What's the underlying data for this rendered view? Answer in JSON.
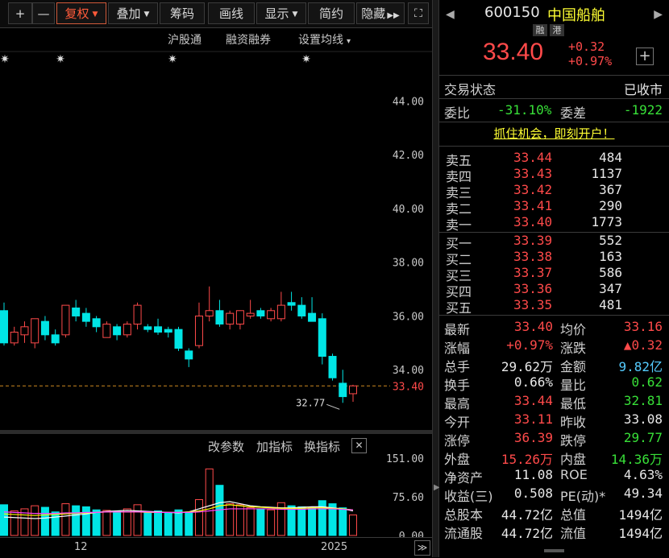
{
  "toolbar": {
    "plus": "+",
    "minus": "—",
    "fuquan": "复权",
    "diejia": "叠加",
    "chouma": "筹码",
    "huaxian": "画线",
    "xianshi": "显示",
    "jianyue": "简约",
    "yincang": "隐藏",
    "fullscreen": "⛶"
  },
  "chart_top": {
    "hugutong": "沪股通",
    "rongzi": "融资融券",
    "shezhi": "设置均线",
    "caret": "▾"
  },
  "price_axis": [
    "44.00",
    "42.00",
    "40.00",
    "38.00",
    "36.00",
    "34.00"
  ],
  "current_price_tag": "33.40",
  "low_annotation": "32.77",
  "volume_toolbar": {
    "gaicanshu": "改参数",
    "jiazhibiao": "加指标",
    "huanzhibiao": "换指标",
    "close": "✕"
  },
  "volume_axis": [
    "151.00",
    "75.60",
    "0.00"
  ],
  "time_axis": {
    "m12": "12",
    "y2025": "2025",
    "more": "≫"
  },
  "colors": {
    "up": "#ff4a4a",
    "down": "#00e5e5",
    "ma1": "#ffffff",
    "ma2": "#ffff00",
    "ma3": "#ff44ff"
  },
  "quote": {
    "code": "600150",
    "name": "中国船舶",
    "badge_rong": "融",
    "badge_gang": "港",
    "price": "33.40",
    "change": "+0.32",
    "change_pct": "+0.97%",
    "add": "+"
  },
  "status": {
    "label": "交易状态",
    "value": "已收市"
  },
  "weibi": {
    "label": "委比",
    "value": "-31.10%",
    "label2": "委差",
    "value2": "-1922"
  },
  "promo": "抓住机会，即刻开户！",
  "sell": [
    {
      "label": "卖五",
      "price": "33.44",
      "vol": "484"
    },
    {
      "label": "卖四",
      "price": "33.43",
      "vol": "1137"
    },
    {
      "label": "卖三",
      "price": "33.42",
      "vol": "367"
    },
    {
      "label": "卖二",
      "price": "33.41",
      "vol": "290"
    },
    {
      "label": "卖一",
      "price": "33.40",
      "vol": "1773"
    }
  ],
  "buy": [
    {
      "label": "买一",
      "price": "33.39",
      "vol": "552"
    },
    {
      "label": "买二",
      "price": "33.38",
      "vol": "163"
    },
    {
      "label": "买三",
      "price": "33.37",
      "vol": "586"
    },
    {
      "label": "买四",
      "price": "33.36",
      "vol": "347"
    },
    {
      "label": "买五",
      "price": "33.35",
      "vol": "481"
    }
  ],
  "stats": [
    {
      "l1": "最新",
      "v1": "33.40",
      "c1": "red",
      "l2": "均价",
      "v2": "33.16",
      "c2": "red"
    },
    {
      "l1": "涨幅",
      "v1": "+0.97%",
      "c1": "red",
      "l2": "涨跌",
      "v2": "▲0.32",
      "c2": "red"
    },
    {
      "l1": "总手",
      "v1": "29.62万",
      "c1": "white",
      "l2": "金额",
      "v2": "9.82亿",
      "c2": "cyan"
    },
    {
      "l1": "换手",
      "v1": "0.66%",
      "c1": "white",
      "l2": "量比",
      "v2": "0.62",
      "c2": "green"
    },
    {
      "l1": "最高",
      "v1": "33.44",
      "c1": "red",
      "l2": "最低",
      "v2": "32.81",
      "c2": "green"
    },
    {
      "l1": "今开",
      "v1": "33.11",
      "c1": "red",
      "l2": "昨收",
      "v2": "33.08",
      "c2": "white"
    },
    {
      "l1": "涨停",
      "v1": "36.39",
      "c1": "red",
      "l2": "跌停",
      "v2": "29.77",
      "c2": "green"
    },
    {
      "l1": "外盘",
      "v1": "15.26万",
      "c1": "red",
      "l2": "内盘",
      "v2": "14.36万",
      "c2": "green"
    },
    {
      "l1": "净资产",
      "v1": "11.08",
      "c1": "white",
      "l2": "ROE",
      "v2": "4.63%",
      "c2": "white"
    },
    {
      "l1": "收益(三)",
      "v1": "0.508",
      "c1": "white",
      "l2": "PE(动)*",
      "v2": "49.34",
      "c2": "white"
    },
    {
      "l1": "总股本",
      "v1": "44.72亿",
      "c1": "white",
      "l2": "总值",
      "v2": "1494亿",
      "c2": "white"
    },
    {
      "l1": "流通股",
      "v1": "44.72亿",
      "c1": "white",
      "l2": "流值",
      "v2": "1494亿",
      "c2": "white"
    }
  ],
  "chart_data": {
    "type": "candlestick",
    "ylim": [
      32.0,
      45.0
    ],
    "current_price": 33.4,
    "low_marker": 32.77,
    "candles": [
      {
        "o": 36.2,
        "h": 36.5,
        "l": 34.9,
        "c": 35.0
      },
      {
        "o": 35.0,
        "h": 35.6,
        "l": 34.9,
        "c": 35.4
      },
      {
        "o": 35.3,
        "h": 35.8,
        "l": 35.0,
        "c": 35.6
      },
      {
        "o": 35.0,
        "h": 35.9,
        "l": 34.8,
        "c": 35.9
      },
      {
        "o": 35.8,
        "h": 36.0,
        "l": 35.1,
        "c": 35.3
      },
      {
        "o": 35.3,
        "h": 35.5,
        "l": 34.9,
        "c": 35.0
      },
      {
        "o": 35.3,
        "h": 36.4,
        "l": 35.2,
        "c": 36.4
      },
      {
        "o": 36.3,
        "h": 36.6,
        "l": 35.8,
        "c": 36.0
      },
      {
        "o": 36.1,
        "h": 36.3,
        "l": 35.6,
        "c": 35.8
      },
      {
        "o": 35.9,
        "h": 36.0,
        "l": 35.4,
        "c": 35.6
      },
      {
        "o": 35.2,
        "h": 35.8,
        "l": 35.2,
        "c": 35.7
      },
      {
        "o": 35.6,
        "h": 35.7,
        "l": 35.1,
        "c": 35.3
      },
      {
        "o": 35.3,
        "h": 35.8,
        "l": 35.2,
        "c": 35.7
      },
      {
        "o": 35.7,
        "h": 36.5,
        "l": 35.5,
        "c": 36.4
      },
      {
        "o": 35.6,
        "h": 35.7,
        "l": 35.4,
        "c": 35.5
      },
      {
        "o": 35.6,
        "h": 35.9,
        "l": 35.3,
        "c": 35.4
      },
      {
        "o": 35.5,
        "h": 35.6,
        "l": 35.2,
        "c": 35.4
      },
      {
        "o": 35.5,
        "h": 35.6,
        "l": 34.7,
        "c": 34.8
      },
      {
        "o": 34.7,
        "h": 34.8,
        "l": 34.1,
        "c": 34.4
      },
      {
        "o": 34.9,
        "h": 36.5,
        "l": 34.8,
        "c": 36.0
      },
      {
        "o": 36.0,
        "h": 37.1,
        "l": 35.8,
        "c": 36.2
      },
      {
        "o": 36.2,
        "h": 36.6,
        "l": 35.6,
        "c": 35.7
      },
      {
        "o": 35.7,
        "h": 36.2,
        "l": 35.5,
        "c": 36.1
      },
      {
        "o": 35.7,
        "h": 36.2,
        "l": 35.5,
        "c": 36.2
      },
      {
        "o": 36.0,
        "h": 36.6,
        "l": 35.9,
        "c": 36.1
      },
      {
        "o": 36.2,
        "h": 36.3,
        "l": 35.9,
        "c": 36.0
      },
      {
        "o": 35.9,
        "h": 36.3,
        "l": 35.8,
        "c": 36.2
      },
      {
        "o": 35.9,
        "h": 36.9,
        "l": 35.8,
        "c": 36.4
      },
      {
        "o": 36.5,
        "h": 36.9,
        "l": 36.2,
        "c": 36.4
      },
      {
        "o": 36.4,
        "h": 36.7,
        "l": 35.9,
        "c": 36.0
      },
      {
        "o": 36.1,
        "h": 36.7,
        "l": 35.8,
        "c": 35.8
      },
      {
        "o": 35.9,
        "h": 36.1,
        "l": 34.2,
        "c": 34.5
      },
      {
        "o": 34.5,
        "h": 34.6,
        "l": 33.6,
        "c": 33.7
      },
      {
        "o": 33.5,
        "h": 34.0,
        "l": 32.77,
        "c": 33.0
      },
      {
        "o": 33.11,
        "h": 33.44,
        "l": 32.81,
        "c": 33.4
      }
    ],
    "volumes": [
      60,
      48,
      52,
      58,
      55,
      46,
      62,
      58,
      56,
      50,
      49,
      47,
      52,
      60,
      46,
      48,
      44,
      50,
      46,
      70,
      130,
      98,
      62,
      60,
      54,
      52,
      50,
      64,
      58,
      56,
      55,
      68,
      62,
      54,
      40
    ],
    "volume_ylim": [
      0,
      151
    ],
    "ma_volume": [
      [
        36,
        35,
        34,
        33,
        34,
        36,
        38,
        40,
        42,
        45,
        47,
        48,
        49,
        48,
        47,
        46,
        45,
        44,
        46,
        52,
        58,
        64,
        66,
        62,
        58,
        56,
        55,
        54,
        54,
        55,
        56,
        56,
        54,
        52,
        48
      ],
      [
        42,
        41,
        40,
        39,
        40,
        41,
        42,
        43,
        44,
        45,
        46,
        46,
        46,
        46,
        45,
        45,
        45,
        45,
        46,
        48,
        52,
        58,
        60,
        58,
        56,
        55,
        54,
        53,
        53,
        53,
        54,
        54,
        53,
        52,
        50
      ],
      [
        46,
        45,
        44,
        43,
        43,
        43,
        44,
        44,
        45,
        45,
        46,
        46,
        46,
        46,
        46,
        45,
        45,
        45,
        45,
        46,
        48,
        50,
        52,
        52,
        52,
        52,
        52,
        51,
        51,
        51,
        52,
        52,
        52,
        51,
        50
      ]
    ]
  }
}
